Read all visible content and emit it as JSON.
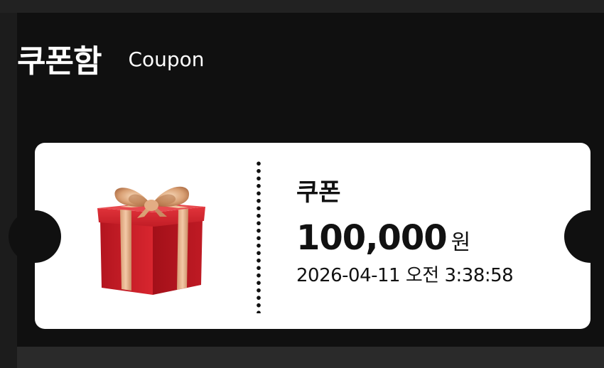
{
  "header": {
    "title_ko": "쿠폰함",
    "title_en": "Coupon"
  },
  "coupon": {
    "label": "쿠폰",
    "amount": "100,000",
    "unit": "원",
    "datetime": "2026-04-11 오전 3:38:58",
    "image_icon": "gift-box-icon"
  },
  "colors": {
    "background": "#101010",
    "card": "#ffffff",
    "gift_red": "#c8202a",
    "ribbon_gold": "#e3b08a"
  }
}
